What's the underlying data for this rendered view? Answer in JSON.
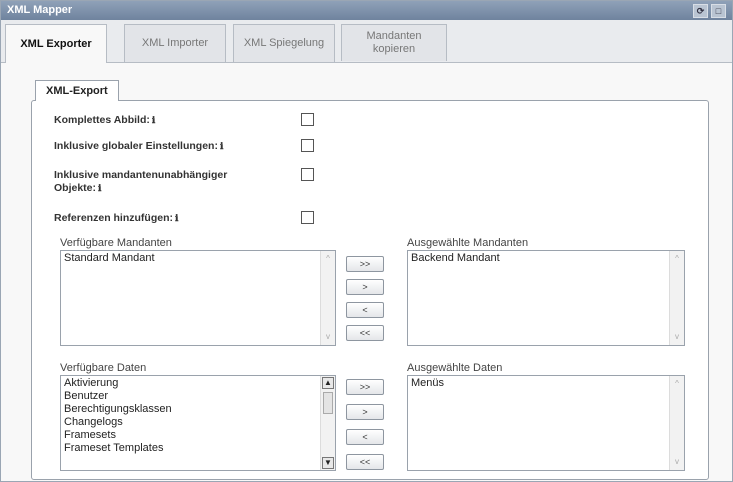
{
  "window": {
    "title": "XML Mapper",
    "controls": [
      {
        "name": "refresh-icon",
        "glyph": "⟳"
      },
      {
        "name": "maximize-icon",
        "glyph": "□"
      }
    ]
  },
  "tabs": [
    {
      "label": "XML Exporter",
      "active": true
    },
    {
      "label": "XML Importer",
      "active": false
    },
    {
      "label": "XML Spiegelung",
      "active": false
    },
    {
      "label": "Mandanten kopieren",
      "active": false
    }
  ],
  "subtab": {
    "label": "XML-Export"
  },
  "options": [
    {
      "label": "Komplettes Abbild:",
      "info": "ℹ",
      "checked": false
    },
    {
      "label": "Inklusive globaler Einstellungen:",
      "info": "ℹ",
      "checked": false
    },
    {
      "label": "Inklusive mandantenunabhängiger Objekte:",
      "info": "ℹ",
      "checked": false
    },
    {
      "label": "Referenzen hinzufügen:",
      "info": "ℹ",
      "checked": false
    }
  ],
  "mandanten": {
    "available_label": "Verfügbare Mandanten",
    "available": [
      "Standard Mandant"
    ],
    "selected_label": "Ausgewählte Mandanten",
    "selected": [
      "Backend Mandant"
    ],
    "buttons": [
      ">>",
      ">",
      "<",
      "<<"
    ]
  },
  "daten": {
    "available_label": "Verfügbare Daten",
    "available": [
      "Aktivierung",
      "Benutzer",
      "Berechtigungsklassen",
      "Changelogs",
      "Framesets",
      "Frameset Templates"
    ],
    "selected_label": "Ausgewählte Daten",
    "selected": [
      "Menüs"
    ],
    "buttons": [
      ">>",
      ">",
      "<",
      "<<"
    ]
  },
  "icons": {
    "scroll_up": "▲",
    "scroll_down": "▼",
    "scroll_up_light": "^",
    "scroll_down_light": "v"
  }
}
